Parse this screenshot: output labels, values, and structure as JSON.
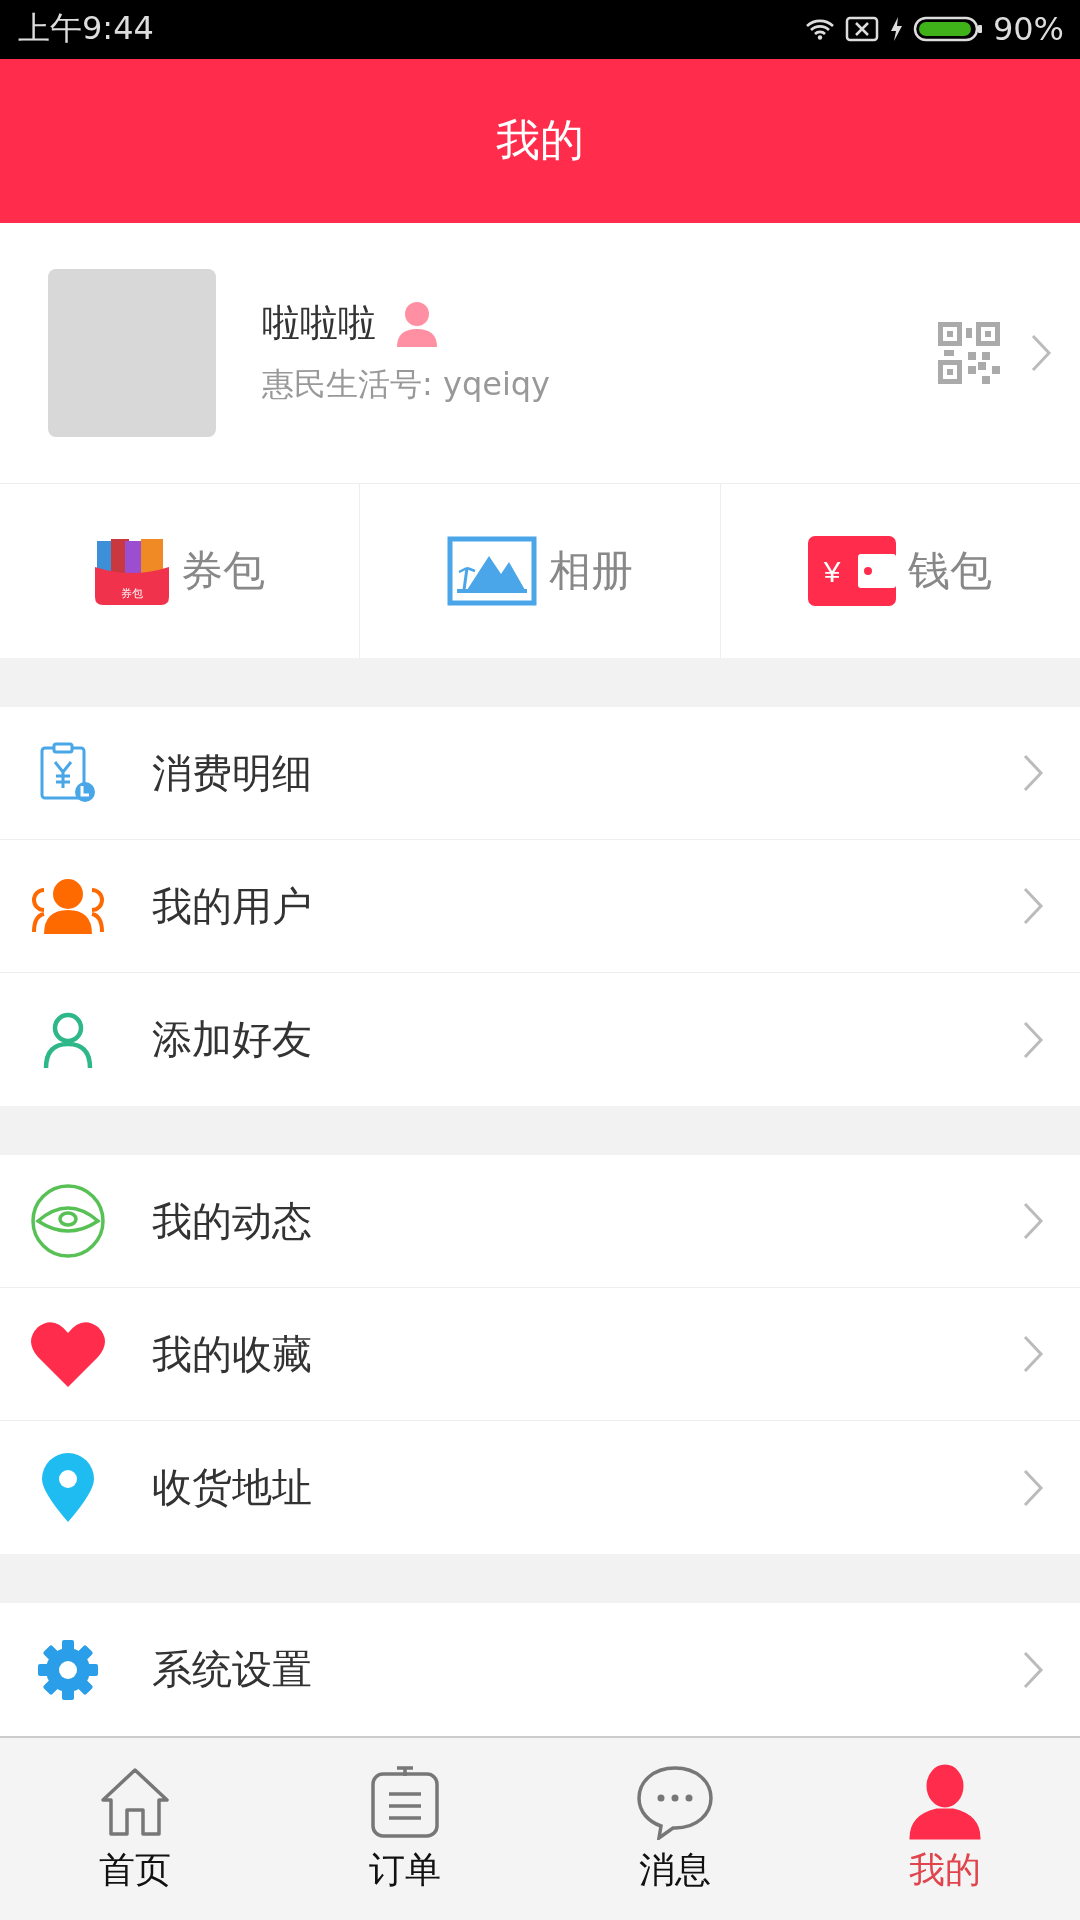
{
  "status_bar": {
    "time": "上午9:44",
    "battery": "90%"
  },
  "header": {
    "title": "我的"
  },
  "profile": {
    "name": "啦啦啦",
    "account": "惠民生活号: yqeiqy"
  },
  "quick_links": [
    {
      "kind": "coupon",
      "label": "券包",
      "icon_text": "券包"
    },
    {
      "kind": "album",
      "label": "相册"
    },
    {
      "kind": "wallet",
      "label": "钱包",
      "icon_text": "¥"
    }
  ],
  "menu_groups": [
    [
      {
        "kind": "bill",
        "label": "消费明细"
      },
      {
        "kind": "users",
        "label": "我的用户"
      },
      {
        "kind": "friend",
        "label": "添加好友"
      }
    ],
    [
      {
        "kind": "eye",
        "label": "我的动态"
      },
      {
        "kind": "heart",
        "label": "我的收藏"
      },
      {
        "kind": "pin",
        "label": "收货地址"
      }
    ],
    [
      {
        "kind": "gear",
        "label": "系统设置"
      }
    ]
  ],
  "tab_bar": [
    {
      "kind": "home",
      "label": "首页",
      "selected": false
    },
    {
      "kind": "orders",
      "label": "订单",
      "selected": false
    },
    {
      "kind": "chat",
      "label": "消息",
      "selected": false
    },
    {
      "kind": "me",
      "label": "我的",
      "selected": true
    }
  ]
}
